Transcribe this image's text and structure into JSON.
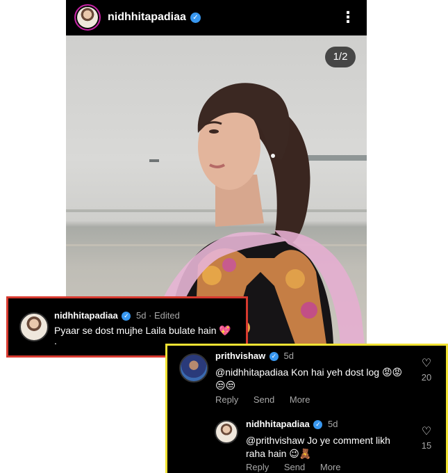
{
  "post": {
    "username": "nidhhitapadiaa",
    "verified_glyph": "✓",
    "menu_glyph": "⋮",
    "page_counter": "1/2"
  },
  "comment_main": {
    "username": "nidhhitapadiaa",
    "meta": "5d · Edited",
    "text_line1": "Pyaar se dost mujhe Laila  bulate hain 💖",
    "text_line2": "."
  },
  "thread": {
    "comment": {
      "username": "prithvishaw",
      "meta": "5d",
      "text_line1": "@nidhhitapadiaa Kon hai yeh dost log 😡😡",
      "text_line2": "😒😒",
      "likes": "20",
      "actions": {
        "reply": "Reply",
        "send": "Send",
        "more": "More"
      }
    },
    "reply": {
      "username": "nidhhitapadiaa",
      "meta": "5d",
      "text_line1": "@prithvishaw Jo ye comment likh",
      "text_line2": "raha hain 😉🧸",
      "likes": "15",
      "actions": {
        "reply": "Reply",
        "send": "Send",
        "more": "More"
      }
    }
  },
  "icons": {
    "heart": "♡",
    "verified": "verified-badge-icon"
  },
  "colors": {
    "verified_blue": "#3897f0",
    "red_frame": "#d7392f",
    "yellow_frame": "#f1e333",
    "story_ring": "#c21ea1"
  }
}
